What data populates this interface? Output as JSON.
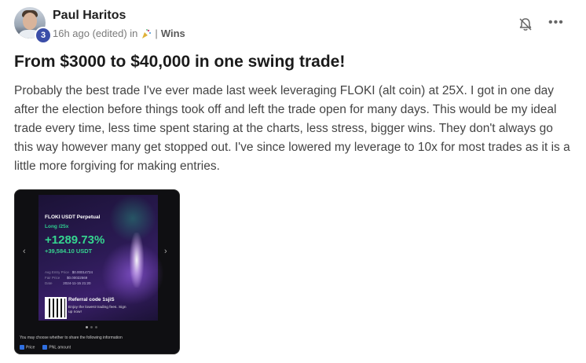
{
  "post": {
    "author": "Paul Haritos",
    "level": "3",
    "time": "16h ago (edited) in",
    "category_separator": "|",
    "category": "Wins",
    "title": "From $3000 to $40,000 in one swing trade!",
    "body": "Probably the best trade I've ever made last week leveraging FLOKI (alt coin) at 25X. I got in one day after the election before things took off and left the trade open for many days. This would be my ideal trade every time, less time spent staring at the charts, less stress, bigger wins. They don't always go this way however many get stopped out. I've since lowered my leverage to 10x for most trades as it is a little more forgiving for making entries."
  },
  "icons": {
    "category": "party-popper-icon",
    "notifications": "bell-off-icon",
    "menu": "more-horizontal-icon"
  },
  "attachment": {
    "pair": "FLOKI USDT Perpetual",
    "position": "Long /25x",
    "pnl_percent": "+1289.73%",
    "pnl_usdt": "+39,584.10 USDT",
    "avg_entry_label": "Avg Entry Price",
    "avg_entry_value": "$0.00014724",
    "fair_price_label": "Fair Price",
    "fair_price_value": "$0.00022569",
    "date_label": "Date",
    "date_value": "2024-11-15 21:20",
    "referral_label": "Referral code",
    "referral_code": "1sjiS",
    "referral_sub": "Enjoy the lowest trading fees. Sign up now!",
    "share_note": "You may choose whether to share the following information",
    "check_price": "Price",
    "check_pnl": "PNL amount",
    "prev": "‹",
    "next": "›"
  },
  "colors": {
    "accent_green": "#35d48f",
    "badge": "#3b4ea8"
  }
}
